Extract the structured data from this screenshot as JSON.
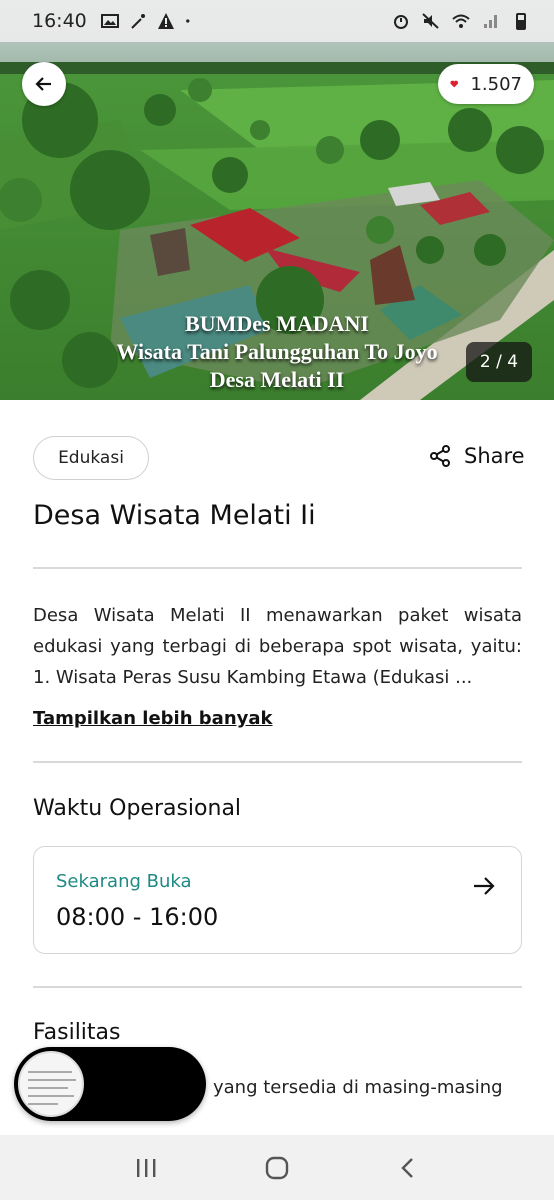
{
  "status_bar": {
    "time": "16:40"
  },
  "hero": {
    "like_count": "1.507",
    "overlay_lines": [
      "BUMDes MADANI",
      "Wisata Tani Palungguhan To Joyo",
      "Desa Melati II"
    ],
    "image_counter": "2 / 4"
  },
  "content": {
    "category": "Edukasi",
    "share_label": "Share",
    "title": "Desa Wisata Melati Ii",
    "description": "Desa Wisata Melati II menawarkan paket wisata edukasi yang terbagi di beberapa spot wisata, yaitu: 1. Wisata Peras Susu Kambing Etawa (Edukasi ...",
    "show_more": "Tampilkan lebih banyak",
    "hours_title": "Waktu Operasional",
    "hours_status": "Sekarang Buka",
    "hours_range": "08:00 - 16:00",
    "facilities_title": "Fasilitas",
    "facilities_text": "yang tersedia di masing-masing"
  },
  "colors": {
    "accent_teal": "#1f8a84",
    "heart_red": "#e0202e"
  }
}
